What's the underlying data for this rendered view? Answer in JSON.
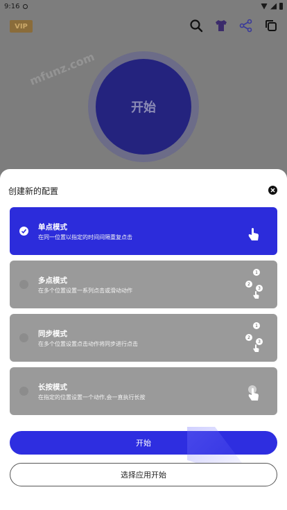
{
  "status_bar": {
    "time": "9:16"
  },
  "header": {
    "vip_label": "VIP",
    "icons": [
      "search-icon",
      "shirt-icon",
      "share-icon",
      "copy-icon"
    ]
  },
  "main": {
    "start_circle_label": "开始"
  },
  "sheet": {
    "title": "创建新的配置",
    "modes": [
      {
        "name": "单点模式",
        "desc": "在同一位置以指定的时间间隔重复点击",
        "selected": true,
        "icon": "single-tap-icon"
      },
      {
        "name": "多点模式",
        "desc": "在多个位置设置一系列点击或滑动动作",
        "selected": false,
        "icon": "multi-tap-icon"
      },
      {
        "name": "同步模式",
        "desc": "在多个位置设置点击动作将同步进行点击",
        "selected": false,
        "icon": "sync-tap-icon"
      },
      {
        "name": "长按模式",
        "desc": "在指定的位置设置一个动作,会一直执行长按",
        "selected": false,
        "icon": "long-press-icon"
      }
    ],
    "start_label": "开始",
    "choose_app_label": "选择应用开始"
  },
  "colors": {
    "accent": "#2e2ee0",
    "selected_card": "#2c2cdb",
    "unselected_card": "#9a9a9a",
    "overlay": "#7d7d7d"
  }
}
